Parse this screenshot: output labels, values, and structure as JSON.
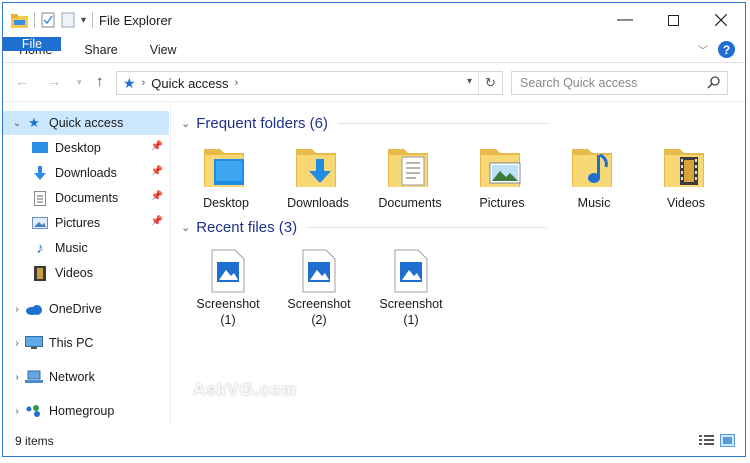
{
  "window": {
    "title": "File Explorer"
  },
  "ribbon": {
    "tabs": [
      "File",
      "Home",
      "Share",
      "View"
    ]
  },
  "address": {
    "path": "Quick access",
    "search_placeholder": "Search Quick access"
  },
  "sidebar": {
    "items": [
      {
        "label": "Quick access"
      },
      {
        "label": "Desktop"
      },
      {
        "label": "Downloads"
      },
      {
        "label": "Documents"
      },
      {
        "label": "Pictures"
      },
      {
        "label": "Music"
      },
      {
        "label": "Videos"
      },
      {
        "label": "OneDrive"
      },
      {
        "label": "This PC"
      },
      {
        "label": "Network"
      },
      {
        "label": "Homegroup"
      }
    ]
  },
  "content": {
    "frequent_header": "Frequent folders (6)",
    "recent_header": "Recent files (3)",
    "folders": [
      {
        "label": "Desktop"
      },
      {
        "label": "Downloads"
      },
      {
        "label": "Documents"
      },
      {
        "label": "Pictures"
      },
      {
        "label": "Music"
      },
      {
        "label": "Videos"
      }
    ],
    "files": [
      {
        "name": "Screenshot",
        "sub": "(1)"
      },
      {
        "name": "Screenshot",
        "sub": "(2)"
      },
      {
        "name": "Screenshot",
        "sub": "(1)"
      }
    ]
  },
  "watermark": "AskVG.com",
  "status": {
    "items": "9 items"
  },
  "colors": {
    "accent": "#1f6fd1",
    "selection": "#cce8ff",
    "group_header": "#1e3287",
    "folder": "#f8d775"
  }
}
